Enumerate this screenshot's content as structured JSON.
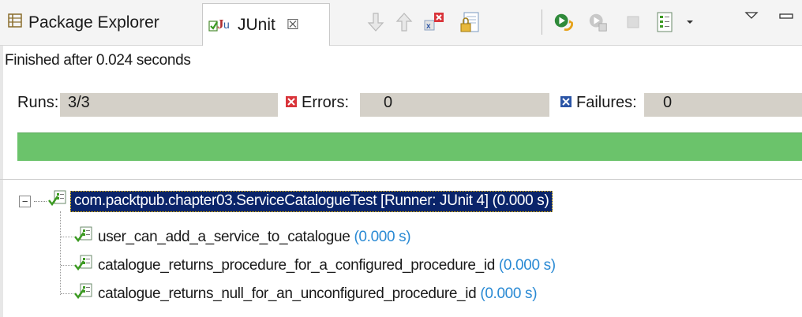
{
  "tabs": {
    "package_explorer": "Package Explorer",
    "junit": "JUnit",
    "close_glyph": "☒"
  },
  "toolbar": {
    "icons": [
      "next-failure-icon",
      "previous-failure-icon",
      "show-failures-only-icon",
      "scroll-lock-icon",
      "rerun-test-icon",
      "rerun-failed-first-icon",
      "stop-icon",
      "test-run-history-icon",
      "dropdown-arrow-icon",
      "view-menu-icon",
      "minimize-icon"
    ]
  },
  "status": "Finished after 0.024 seconds",
  "counters": {
    "runs_label": "Runs:",
    "runs_value": "3/3",
    "errors_label": "Errors:",
    "errors_value": "0",
    "failures_label": "Failures:",
    "failures_value": "0"
  },
  "progress": {
    "fraction": 1.0,
    "color": "#6bc36b"
  },
  "tree": {
    "root": {
      "label": "com.packtpub.chapter03.ServiceCatalogueTest [Runner: JUnit 4] (0.000 s)"
    },
    "children": [
      {
        "name": "user_can_add_a_service_to_catalogue",
        "time": "(0.000 s)"
      },
      {
        "name": "catalogue_returns_procedure_for_a_configured_procedure_id",
        "time": "(0.000 s)"
      },
      {
        "name": "catalogue_returns_null_for_an_unconfigured_procedure_id",
        "time": "(0.000 s)"
      }
    ]
  },
  "colors": {
    "selection_bg": "#0a246a",
    "time_text": "#2a8ad4",
    "error_red": "#d9343a",
    "failure_blue": "#2b55a6"
  }
}
